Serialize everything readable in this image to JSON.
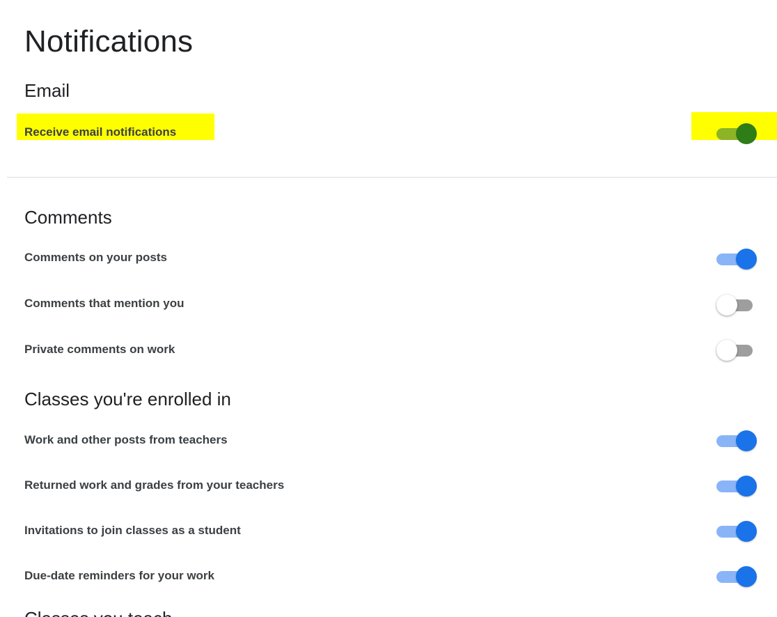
{
  "page": {
    "title": "Notifications"
  },
  "email": {
    "heading": "Email",
    "receive_label": "Receive email notifications",
    "receive_on": true
  },
  "comments": {
    "heading": "Comments",
    "items": [
      {
        "label": "Comments on your posts",
        "on": true
      },
      {
        "label": "Comments that mention you",
        "on": false
      },
      {
        "label": "Private comments on work",
        "on": false
      }
    ]
  },
  "enrolled": {
    "heading": "Classes you're enrolled in",
    "items": [
      {
        "label": "Work and other posts from teachers",
        "on": true
      },
      {
        "label": "Returned work and grades from your teachers",
        "on": true
      },
      {
        "label": "Invitations to join classes as a student",
        "on": true
      },
      {
        "label": "Due-date reminders for your work",
        "on": true
      }
    ]
  },
  "next_section": {
    "heading_partial": "Classes you teach"
  },
  "colors": {
    "highlight": "#ffff00",
    "toggle_on_track": "#8ab4f8",
    "toggle_on_thumb": "#1a73e8",
    "toggle_off_track": "#9e9e9e",
    "toggle_off_thumb": "#ffffff",
    "divider": "#dadce0"
  }
}
